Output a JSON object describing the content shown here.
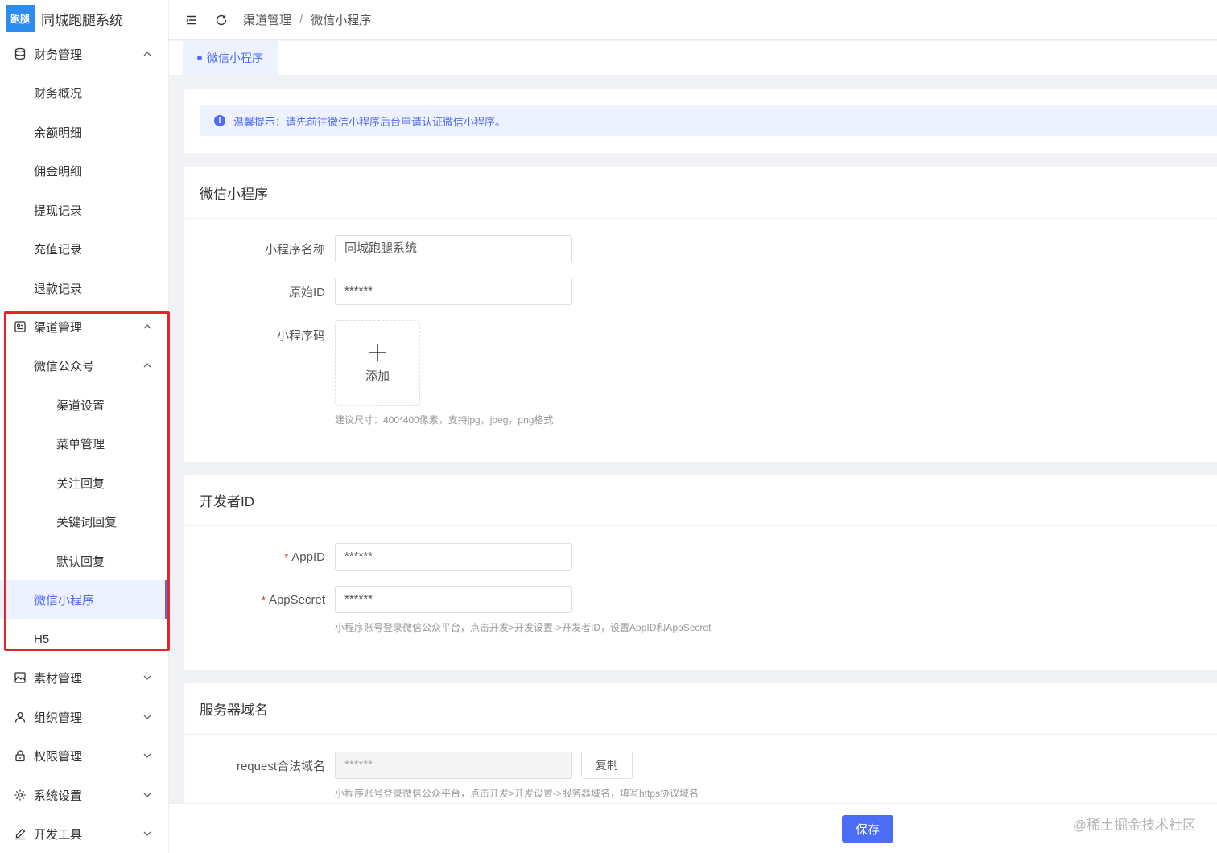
{
  "app": {
    "logo_badge": "跑腿",
    "title": "同城跑腿系统"
  },
  "sidebar": {
    "finance": {
      "label": "财务管理",
      "children": [
        "财务概况",
        "余额明细",
        "佣金明细",
        "提现记录",
        "充值记录",
        "退款记录"
      ]
    },
    "channel": {
      "label": "渠道管理",
      "wechat_official": {
        "label": "微信公众号",
        "children": [
          "渠道设置",
          "菜单管理",
          "关注回复",
          "关键词回复",
          "默认回复"
        ]
      },
      "mini_program": "微信小程序",
      "h5": "H5"
    },
    "material": "素材管理",
    "organization": "组织管理",
    "permission": "权限管理",
    "system": "系统设置",
    "devtools": "开发工具"
  },
  "header": {
    "breadcrumb": [
      "渠道管理",
      "微信小程序"
    ],
    "separator": "/"
  },
  "tabs": [
    {
      "label": "微信小程序"
    }
  ],
  "alert": {
    "icon": "!",
    "text": "温馨提示：请先前往微信小程序后台申请认证微信小程序。"
  },
  "mini_program_card": {
    "title": "微信小程序",
    "name_label": "小程序名称",
    "name_value": "同城跑腿系统",
    "original_id_label": "原始ID",
    "original_id_value": "******",
    "qrcode_label": "小程序码",
    "upload_label": "添加",
    "qrcode_hint": "建议尺寸：400*400像素，支持jpg，jpeg，png格式"
  },
  "developer_card": {
    "title": "开发者ID",
    "required_mark": "*",
    "appid_label": "AppID",
    "appid_value": "******",
    "appsecret_label": "AppSecret",
    "appsecret_value": "******",
    "hint": "小程序账号登录微信公众平台，点击开发>开发设置->开发者ID，设置AppID和AppSecret"
  },
  "server_card": {
    "title": "服务器域名",
    "request_label": "request合法域名",
    "request_value": "******",
    "copy_label": "复制",
    "hint": "小程序账号登录微信公众平台，点击开发>开发设置->服务器域名，填写https协议域名"
  },
  "footer": {
    "save_label": "保存",
    "watermark": "@稀土掘金技术社区"
  },
  "colors": {
    "primary": "#4a6cf7",
    "highlight_border": "#e4262b",
    "logo_bg": "#2d8cf0"
  }
}
